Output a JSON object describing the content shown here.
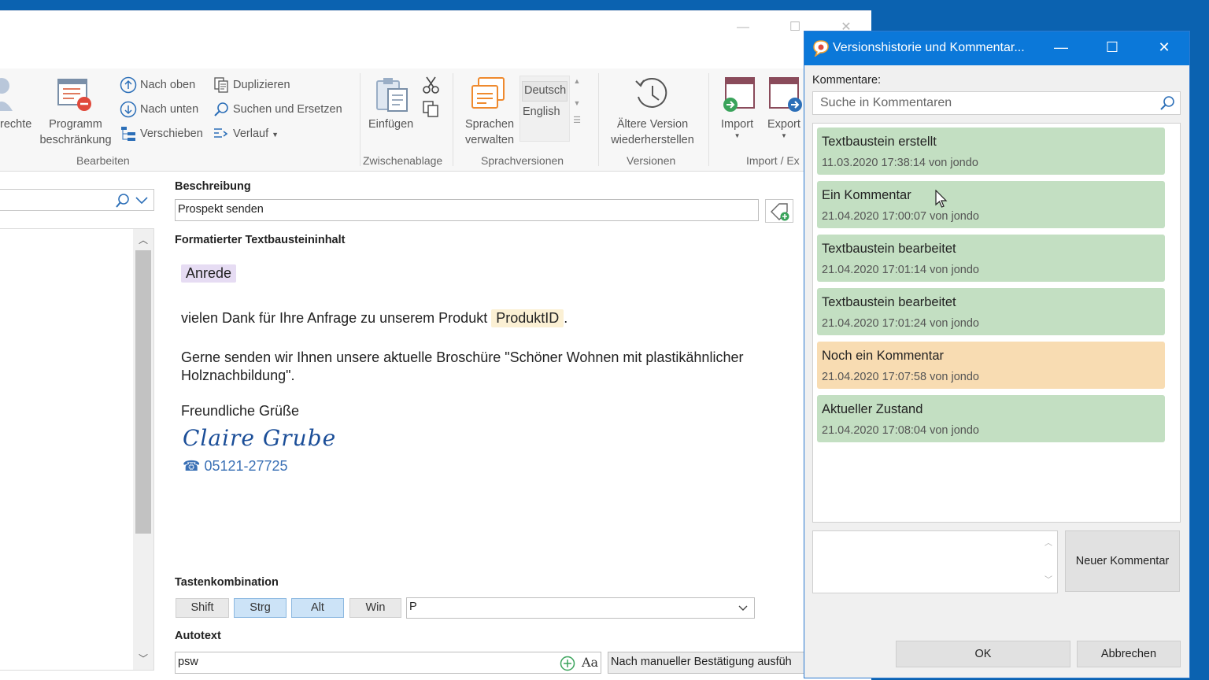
{
  "ribbon": {
    "cut_label": "rechte",
    "program_label_1": "Programm",
    "program_label_2": "beschränkung",
    "move_up": "Nach oben",
    "move_down": "Nach unten",
    "move": "Verschieben",
    "duplicate": "Duplizieren",
    "search_replace": "Suchen und Ersetzen",
    "history": "Verlauf",
    "group_edit": "Bearbeiten",
    "paste": "Einfügen",
    "group_clipboard": "Zwischenablage",
    "languages_1": "Sprachen",
    "languages_2": "verwalten",
    "lang_de": "Deutsch",
    "lang_en": "English",
    "group_lang": "Sprachversionen",
    "restore_1": "Ältere Version",
    "restore_2": "wiederherstellen",
    "group_versions": "Versionen",
    "import": "Import",
    "export": "Export",
    "group_import": "Import / Ex"
  },
  "editor": {
    "description_label": "Beschreibung",
    "description_value": "Prospekt senden",
    "content_label": "Formatierter Textbausteininhalt",
    "chip_anrede": "Anrede",
    "line1_pre": "vielen Dank für Ihre Anfrage zu unserem Produkt ",
    "chip_produkt": "ProduktID",
    "line1_post": ".",
    "line2": "Gerne senden wir Ihnen unsere aktuelle Broschüre \"Schöner Wohnen mit plastikähnlicher",
    "line3": "Holznachbildung\".",
    "greeting": "Freundliche Grüße",
    "signature": "Claire Grube",
    "phone": "05121-27725",
    "shortcut_label": "Tastenkombination",
    "key_shift": "Shift",
    "key_ctrl": "Strg",
    "key_alt": "Alt",
    "key_win": "Win",
    "key_value": "P",
    "autotext_label": "Autotext",
    "autotext_value": "psw",
    "autotext_aa": "Aa",
    "autotext_mode": "Nach manueller Bestätigung ausfüh"
  },
  "dialog": {
    "title": "Versionshistorie und Kommentar...",
    "comments_label": "Kommentare:",
    "search_placeholder": "Suche in Kommentaren",
    "comments": [
      {
        "title": "Textbaustein erstellt",
        "meta": "11.03.2020 17:38:14 von jondo",
        "color": "#c3dfc2"
      },
      {
        "title": "Ein Kommentar",
        "meta": "21.04.2020 17:00:07 von jondo",
        "color": "#c3dfc2"
      },
      {
        "title": "Textbaustein bearbeitet",
        "meta": "21.04.2020 17:01:14 von jondo",
        "color": "#c3dfc2"
      },
      {
        "title": "Textbaustein bearbeitet",
        "meta": "21.04.2020 17:01:24 von jondo",
        "color": "#c3dfc2"
      },
      {
        "title": "Noch ein Kommentar",
        "meta": "21.04.2020 17:07:58 von jondo",
        "color": "#f8dcb2"
      },
      {
        "title": "Aktueller Zustand",
        "meta": "21.04.2020 17:08:04 von jondo",
        "color": "#c3dfc2"
      }
    ],
    "new_comment": "Neuer Kommentar",
    "ok": "OK",
    "cancel": "Abbrechen"
  },
  "colors": {
    "accent": "#0b78d9",
    "desktop": "#0b62b0",
    "chip_anrede": "#e6dcf3",
    "chip_produkt": "#fbf0d4",
    "key_active": "#cce3f7"
  }
}
